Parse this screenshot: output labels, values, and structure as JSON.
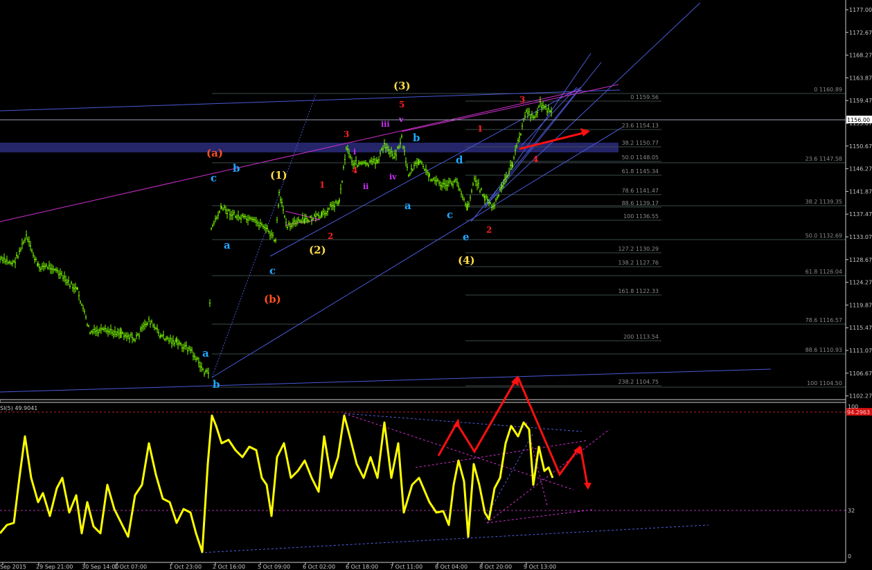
{
  "colors": {
    "background": "#000000",
    "candles": "#7CFC00",
    "rsi_line": "#FFFF00",
    "trend_lines": "#4a5ad8",
    "pink_lines": "#d030d0",
    "red_arrow": "#ff1010",
    "zone": "#25256a",
    "fib_lines": "#3c4a4a",
    "axis_text": "#c8c8c8",
    "current_price_bg": "#ffffff",
    "rsi_marker_bg": "#d01010"
  },
  "price_axis": {
    "ticks": [
      "1177.00",
      "1172.67",
      "1168.27",
      "1163.87",
      "1159.47",
      "1155.07",
      "1150.67",
      "1146.27",
      "1141.87",
      "1137.47",
      "1133.07",
      "1128.67",
      "1124.27",
      "1119.87",
      "1115.47",
      "1111.07",
      "1106.67",
      "1102.27"
    ],
    "current_price": "1156.00"
  },
  "time_axis": {
    "ticks": [
      "Sep 2015",
      "29 Sep 21:00",
      "30 Sep 14:00",
      "1 Oct 07:00",
      "1 Oct 23:00",
      "2 Oct 16:00",
      "5 Oct 09:00",
      "6 Oct 02:00",
      "6 Oct 18:00",
      "7 Oct 11:00",
      "8 Oct 04:00",
      "8 Oct 20:00",
      "9 Oct 13:00"
    ]
  },
  "rsi": {
    "title": "SI(5) 49.9041",
    "axis_ticks": [
      "100",
      "32",
      "0"
    ],
    "marker_value": "94.2963"
  },
  "fib_levels": {
    "right": [
      "0 1160.89",
      "23.6 1147.58",
      "38.2 1139.35",
      "50.0 1132.69",
      "61.8 1126.04",
      "78.6 1116.57",
      "88.6 1110.93",
      "100 1104.50"
    ],
    "middle": [
      "0 1159.56",
      "23.6 1154.13",
      "38.2 1150.77",
      "50.0 1148.05",
      "61.8 1145.34",
      "78.6 1141.47",
      "88.6 1139.17",
      "100 1136.55",
      "127.2 1130.29",
      "138.2 1127.76",
      "161.8 1122.33",
      "200 1113.54",
      "238.2 1104.75"
    ]
  },
  "wave_labels": {
    "yellow": [
      "(3)",
      "(1)",
      "(2)",
      "(4)"
    ],
    "orange": [
      "(a)",
      "(b)"
    ],
    "red": [
      "3",
      "5",
      "1",
      "4",
      "2",
      "1",
      "2",
      "3",
      "4"
    ],
    "magenta": [
      "iii",
      "v",
      "i",
      "ii",
      "iv"
    ],
    "cyan": [
      "c",
      "b",
      "a",
      "a",
      "b",
      "c",
      "b",
      "d",
      "a",
      "c",
      "e"
    ]
  },
  "chart_data": {
    "type": "candlestick",
    "title": "",
    "instrument_price_range": [
      1102.27,
      1177.0
    ],
    "current_price": 1156.0,
    "approximate_close_path": [
      {
        "x": "Sep 2015",
        "close": 1129.5
      },
      {
        "x": "29 Sep 21:00",
        "close": 1127.5
      },
      {
        "x": "30 Sep 14:00",
        "close": 1116.0
      },
      {
        "x": "1 Oct 07:00",
        "close": 1117.0
      },
      {
        "x": "1 Oct 23:00",
        "close": 1107.0
      },
      {
        "x": "2 Oct 16:00",
        "close": 1138.5
      },
      {
        "x": "5 Oct 09:00",
        "close": 1135.0
      },
      {
        "x": "6 Oct 02:00",
        "close": 1138.0
      },
      {
        "x": "6 Oct 18:00",
        "close": 1147.0
      },
      {
        "x": "7 Oct 11:00",
        "close": 1146.0
      },
      {
        "x": "8 Oct 04:00",
        "close": 1140.5
      },
      {
        "x": "8 Oct 20:00",
        "close": 1140.0
      },
      {
        "x": "9 Oct 13:00",
        "close": 1156.0
      }
    ],
    "rsi_period": 5,
    "rsi_last": 49.9041,
    "rsi_levels": [
      100,
      32,
      0
    ]
  }
}
